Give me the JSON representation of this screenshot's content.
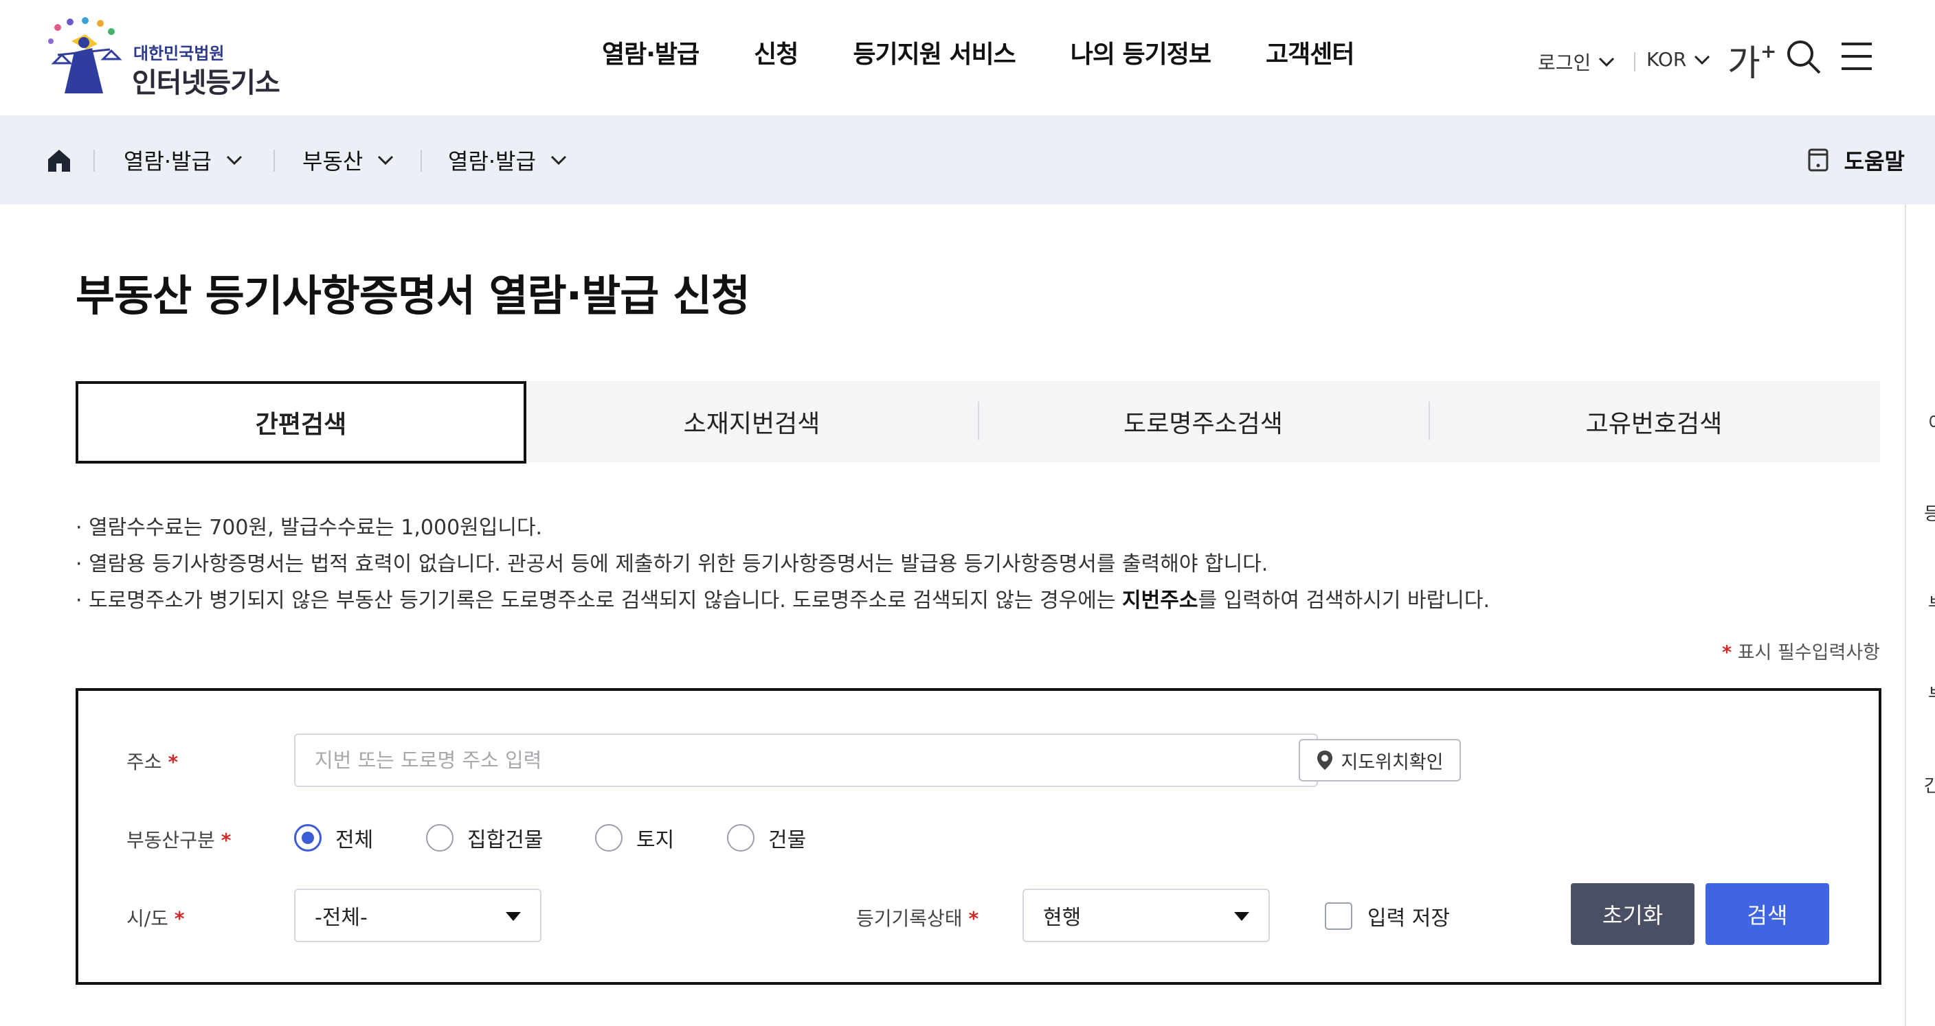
{
  "header": {
    "logo_sub": "대한민국법원",
    "logo_main": "인터넷등기소",
    "nav": [
      "열람·발급",
      "신청",
      "등기지원 서비스",
      "나의 등기정보",
      "고객센터"
    ],
    "login": "로그인",
    "language": "KOR",
    "font_size_label": "가",
    "font_size_plus": "+"
  },
  "breadcrumb": {
    "items": [
      "열람·발급",
      "부동산",
      "열람·발급"
    ],
    "help": "도움말"
  },
  "page": {
    "title": "부동산 등기사항증명서 열람·발급 신청"
  },
  "tabs": [
    {
      "label": "간편검색",
      "active": true
    },
    {
      "label": "소재지번검색",
      "active": false
    },
    {
      "label": "도로명주소검색",
      "active": false
    },
    {
      "label": "고유번호검색",
      "active": false
    }
  ],
  "notes": {
    "line1": "· 열람수수료는  700원, 발급수수료는  1,000원입니다.",
    "line2": "· 열람용 등기사항증명서는 법적 효력이 없습니다. 관공서 등에 제출하기 위한 등기사항증명서는 발급용 등기사항증명서를 출력해야 합니다.",
    "line3_a": "· 도로명주소가 병기되지 않은 부동산 등기기록은 도로명주소로 검색되지 않습니다. 도로명주소로 검색되지 않는 경우에는 ",
    "line3_bold": "지번주소",
    "line3_b": "를 입력하여 검색하시기 바랍니다.",
    "required_star": "*",
    "required_text": " 표시 필수입력사항"
  },
  "form": {
    "address_label": "주소",
    "address_placeholder": "지번 또는 도로명 주소 입력",
    "map_button": "지도위치확인",
    "type_label": "부동산구분",
    "type_options": [
      "전체",
      "집합건물",
      "토지",
      "건물"
    ],
    "type_selected": "전체",
    "region_label": "시/도",
    "region_value": "-전체-",
    "status_label": "등기기록상태",
    "status_value": "현행",
    "save_input_label": "입력 저장",
    "reset_button": "초기화",
    "search_button": "검색",
    "required_mark": "*"
  },
  "edge_fragments": [
    "이",
    "등",
    "부",
    "부",
    "간"
  ],
  "colors": {
    "accent": "#3f66e0",
    "radio_selected": "#3e5bd6",
    "reset_button": "#4a4f63",
    "required": "#d12a2a",
    "breadcrumb_bg": "#eceff5",
    "logo_text": "#2e3a8c"
  }
}
